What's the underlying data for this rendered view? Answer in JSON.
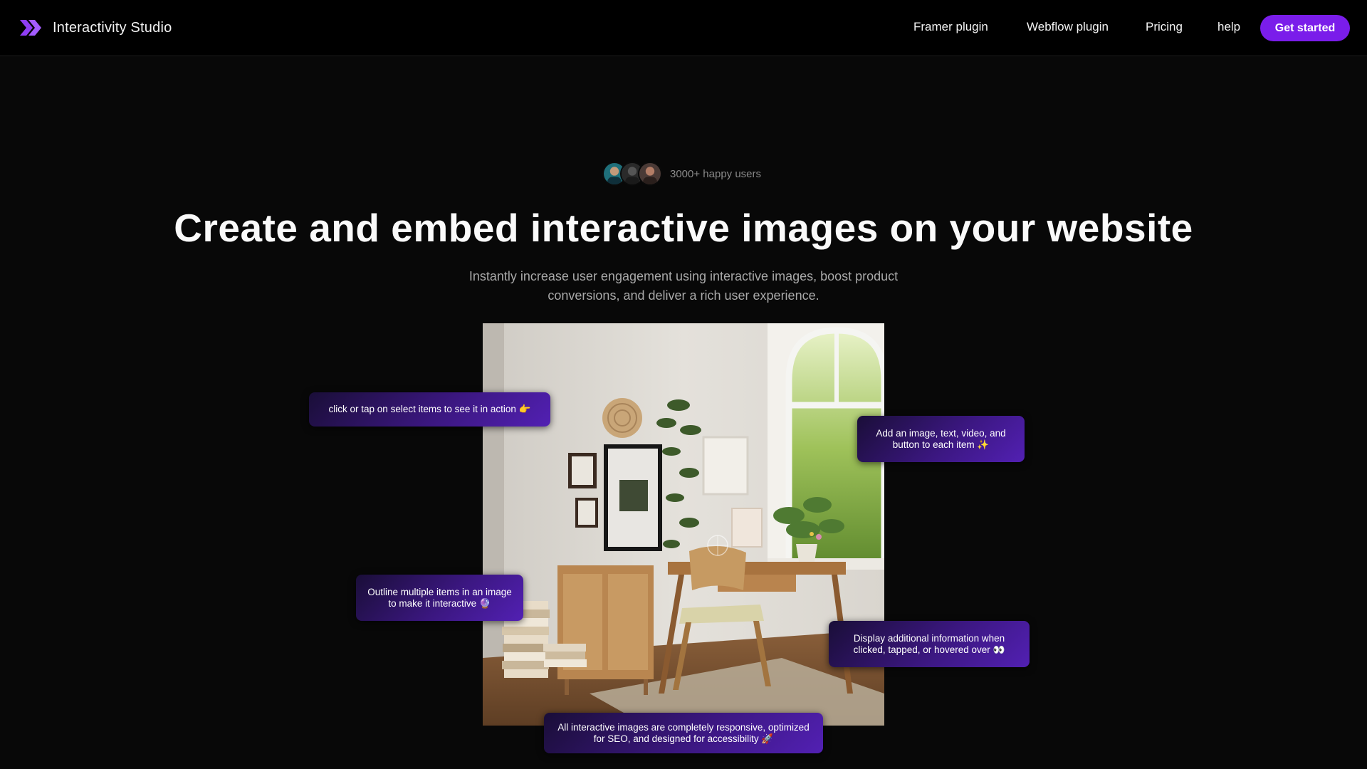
{
  "nav": {
    "brand": "Interactivity Studio",
    "links": [
      "Framer plugin",
      "Webflow plugin",
      "Pricing",
      "help"
    ],
    "cta": "Get started"
  },
  "hero": {
    "social_proof": "3000+ happy users",
    "headline": "Create and embed interactive images on your website",
    "subhead": "Instantly increase user engagement using interactive images, boost product conversions, and deliver a rich user experience."
  },
  "tooltips": {
    "click_hint": "click or tap on select items to see it in action 👉",
    "add_content": "Add an image, text, video, and button to each item ✨",
    "outline_items": "Outline multiple items in an image to make it interactive 🔮",
    "display_info": "Display additional information when clicked, tapped, or hovered over 👀",
    "responsive": "All interactive images are completely responsive, optimized for SEO, and designed for accessibility 🚀"
  },
  "colors": {
    "accent": "#7a1dea",
    "background": "#080808",
    "tooltip": "#3b1780"
  }
}
